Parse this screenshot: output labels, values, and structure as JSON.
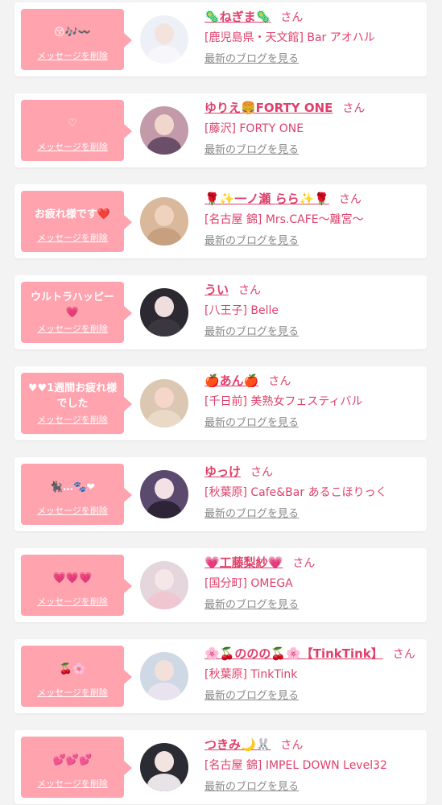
{
  "colors": {
    "bubble": "#ffa3ae",
    "accent": "#e0406b",
    "muted": "#8a8a8a",
    "background": "#f3f3f3"
  },
  "labels": {
    "delete": "メッセージを削除",
    "blog": "最新のブログを見る",
    "honorific": "さん"
  },
  "entries": [
    {
      "message": "😚🎶〰️",
      "name": "🦠ねぎま🦠",
      "shop": "[鹿児島県・天文館] Bar アオハル"
    },
    {
      "message": "♡",
      "name": "ゆりえ🍔FORTY ONE",
      "shop": "[藤沢] FORTY ONE"
    },
    {
      "message": "お疲れ様です❤️",
      "name": "🌹✨一ノ瀬 らら✨🌹",
      "shop": "[名古屋 錦] Mrs.CAFE〜離宮〜"
    },
    {
      "message": "ウルトラハッピー💗",
      "name": "うい",
      "shop": "[八王子] Belle"
    },
    {
      "message": "♥︎♥︎1週間お疲れ様でした",
      "name": "🍎あん🍎",
      "shop": "[千日前] 美熟女フェスティバル"
    },
    {
      "message": "🐈‍⬛…🐾❤",
      "name": "ゆっけ",
      "shop": "[秋葉原] Cafe&Bar あるこほりっく"
    },
    {
      "message": "💗💗💗",
      "name": "💗工藤梨紗💗",
      "shop": "[国分町] OMEGA"
    },
    {
      "message": "🍒🌸",
      "name": "🌸🍒ののの🍒🌸【TinkTink】",
      "shop": "[秋葉原] TinkTink"
    },
    {
      "message": "💕💕💕",
      "name": "つきみ🌙🐰",
      "shop": "[名古屋 錦] IMPEL DOWN Level32"
    }
  ]
}
